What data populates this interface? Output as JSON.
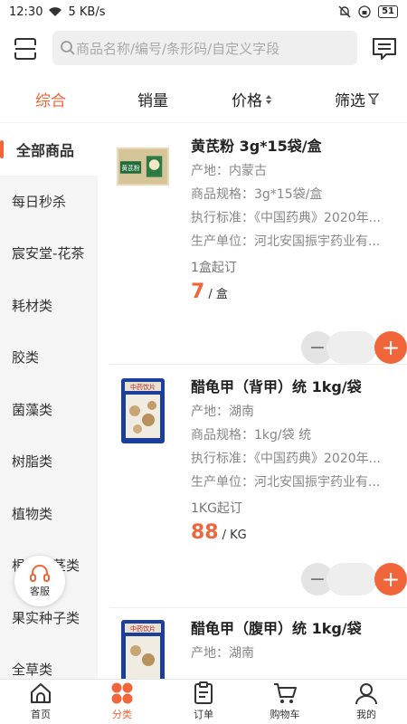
{
  "status": {
    "time": "12:30",
    "net": "5 KB/s",
    "battery": "51"
  },
  "search": {
    "placeholder": "商品名称/编号/条形码/自定义字段"
  },
  "tabs": {
    "comprehensive": "综合",
    "sales": "销量",
    "price": "价格",
    "filter": "筛选"
  },
  "sidebar": {
    "items": [
      {
        "label": "全部商品"
      },
      {
        "label": "每日秒杀"
      },
      {
        "label": "宸安堂-花茶"
      },
      {
        "label": "耗材类"
      },
      {
        "label": "胶类"
      },
      {
        "label": "菌藻类"
      },
      {
        "label": "树脂类"
      },
      {
        "label": "植物类"
      },
      {
        "label": "根及根茎类"
      },
      {
        "label": "果实种子类"
      },
      {
        "label": "全草类"
      }
    ]
  },
  "kefu": {
    "label": "客服"
  },
  "products": [
    {
      "name": "黄芪粉  3g*15袋/盒",
      "origin": "产地：内蒙古",
      "spec": "商品规格：3g*15袋/盒",
      "standard": "执行标准：《中国药典》2020年...",
      "maker": "生产单位：河北安国振宇药业有...",
      "moq": "1盒起订",
      "price": "7",
      "unit": "/ 盒",
      "image_label": "黄芪粉"
    },
    {
      "name": "醋龟甲（背甲）统   1kg/袋",
      "origin": "产地：湖南",
      "spec": "商品规格：1kg/袋 统",
      "standard": "执行标准：《中国药典》2020年...",
      "maker": "生产单位：河北安国振宇药业有...",
      "moq": "1KG起订",
      "price": "88",
      "unit": "/ KG",
      "image_label": "中药饮片"
    },
    {
      "name": "醋龟甲（腹甲）统   1kg/袋",
      "origin": "产地：湖南",
      "image_label": "中药饮片"
    }
  ],
  "nav": {
    "home": "首页",
    "category": "分类",
    "orders": "订单",
    "cart": "购物车",
    "mine": "我的"
  },
  "colors": {
    "accent": "#f0663a",
    "sidebar_bg": "#f5f5f5"
  }
}
